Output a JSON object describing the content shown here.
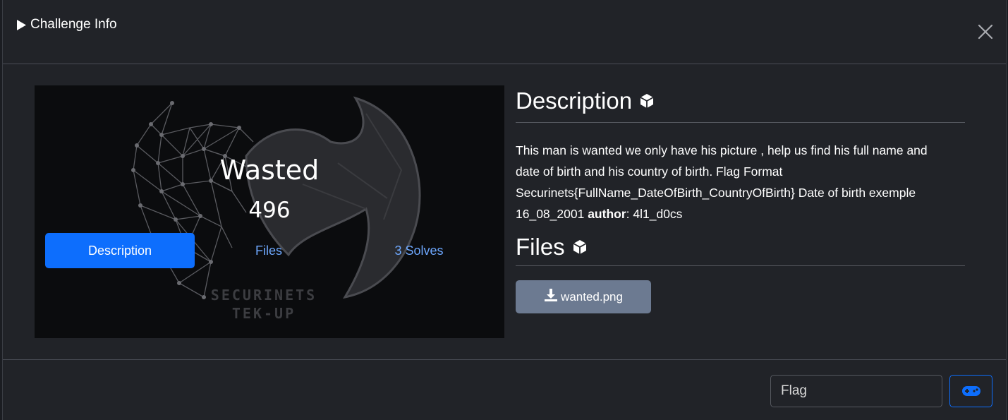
{
  "modal": {
    "title": "Challenge Info",
    "close_label": "Close"
  },
  "challenge": {
    "name": "Wasted",
    "points": "496",
    "banner_brand_line1": "SECURINETS",
    "banner_brand_line2": "TEK-UP"
  },
  "tabs": [
    {
      "label": "Description",
      "active": true
    },
    {
      "label": "Files",
      "active": false
    },
    {
      "label": "3 Solves",
      "active": false
    }
  ],
  "description": {
    "heading": "Description",
    "text": "This man is wanted we only have his picture , help us find his full name and date of birth and his country of birth. Flag Format Securinets{FullName_DateOfBirth_CountryOfBirth} Date of birth exemple 16_08_2001 ",
    "author_label": "author",
    "author_value": ": 4l1_d0cs"
  },
  "files": {
    "heading": "Files",
    "items": [
      {
        "name": "wanted.png",
        "icon": "download-icon"
      }
    ]
  },
  "footer": {
    "flag_placeholder": "Flag",
    "flag_value": "",
    "submit_icon": "gamepad-icon"
  },
  "colors": {
    "background": "#212328",
    "accent": "#0d6efd",
    "link": "#6ea8fe",
    "file_button": "#6c7a91"
  }
}
